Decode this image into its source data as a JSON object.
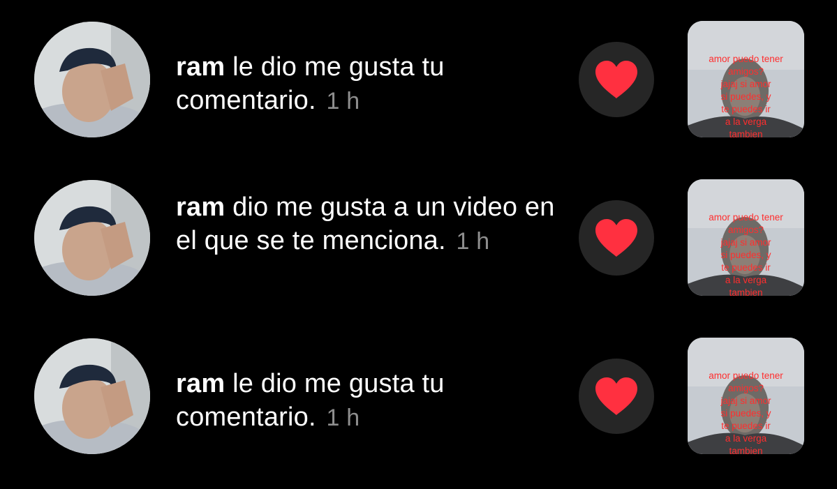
{
  "notifications": [
    {
      "username": "ram",
      "message": "le dio me gusta tu comentario.",
      "time": "1 h",
      "reaction_icon": "heart-icon",
      "thumbnail_caption": "amor puedo tener\namigos?\njajaj si amor\nsi puedes, y\nte puedes ir\na la verga\ntambien"
    },
    {
      "username": "ram",
      "message": "dio me gusta a un video en el que se te menciona.",
      "time": "1 h",
      "reaction_icon": "heart-icon",
      "thumbnail_caption": "amor puedo tener\namigos?\njajaj si amor\nsi puedes, y\nte puedes ir\na la verga\ntambien"
    },
    {
      "username": "ram",
      "message": "le dio me gusta tu comentario.",
      "time": "1 h",
      "reaction_icon": "heart-icon",
      "thumbnail_caption": "amor puedo tener\namigos?\njajaj si amor\nsi puedes, y\nte puedes ir\na la verga\ntambien"
    }
  ],
  "colors": {
    "background": "#000000",
    "text": "#ffffff",
    "timestamp": "#8e8e8e",
    "reaction_bg": "#262626",
    "heart": "#ff3040",
    "caption": "#ff2e2e"
  }
}
